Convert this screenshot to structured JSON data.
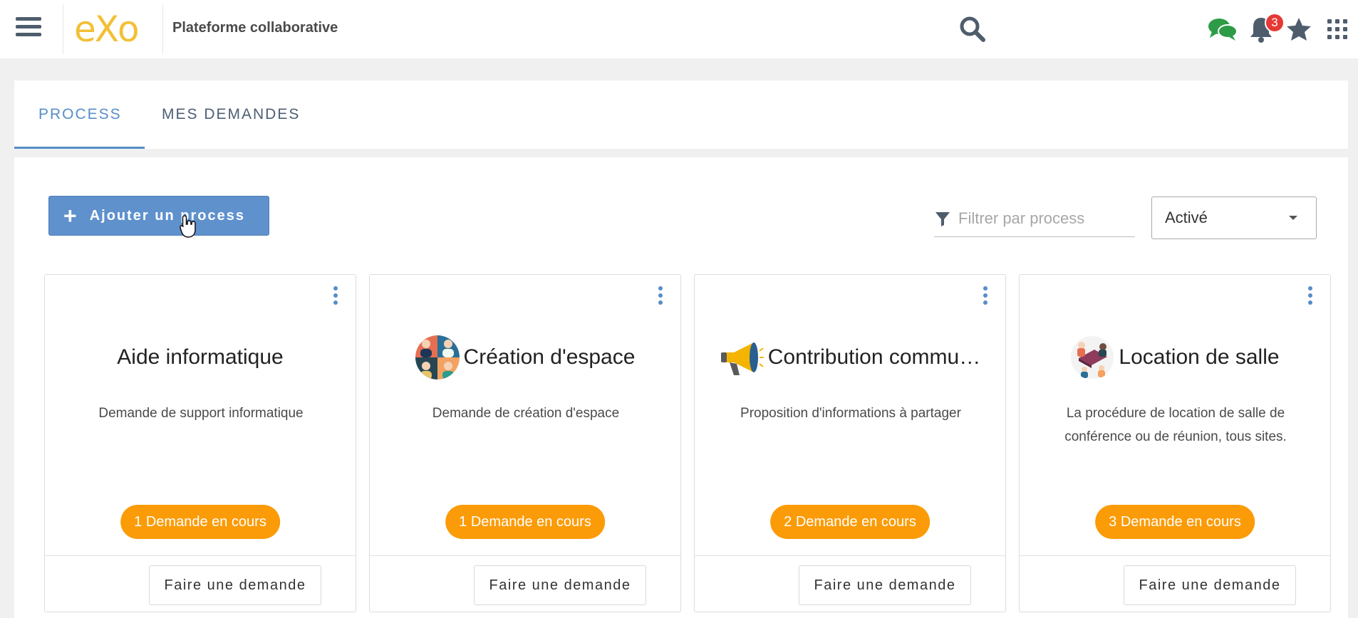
{
  "header": {
    "brand_logo_text": "eXo",
    "title": "Plateforme collaborative",
    "notifications_count": "3",
    "icons": [
      "menu-icon",
      "search-icon",
      "chat-icon",
      "bell-icon",
      "star-icon",
      "apps-grid-icon"
    ]
  },
  "tabs": [
    {
      "label": "PROCESS",
      "active": true
    },
    {
      "label": "MES DEMANDES",
      "active": false
    }
  ],
  "toolbar": {
    "add_label": "Ajouter un process",
    "filter_placeholder": "Filtrer par process",
    "status_value": "Activé"
  },
  "cards": [
    {
      "title": "Aide informatique",
      "description": "Demande de support informatique",
      "pending": "1 Demande en cours",
      "action": "Faire une demande",
      "icon": null
    },
    {
      "title": "Création d'espace",
      "description": "Demande de création d'espace",
      "pending": "1 Demande en cours",
      "action": "Faire une demande",
      "icon": "people-group-icon"
    },
    {
      "title": "Contribution commu…",
      "description": "Proposition d'informations à partager",
      "pending": "2 Demande en cours",
      "action": "Faire une demande",
      "icon": "megaphone-icon"
    },
    {
      "title": "Location de salle",
      "description": "La procédure de location de salle de conférence ou de réunion, tous sites.",
      "pending": "3 Demande en cours",
      "action": "Faire une demande",
      "icon": "meeting-room-icon"
    }
  ],
  "colors": {
    "accent": "#578dc9",
    "primary_button": "#5f91cd",
    "pending_pill": "#fb9b07",
    "badge": "#e53935",
    "chat_icon": "#2e9c47",
    "logo_yellow": "#f2c037"
  }
}
